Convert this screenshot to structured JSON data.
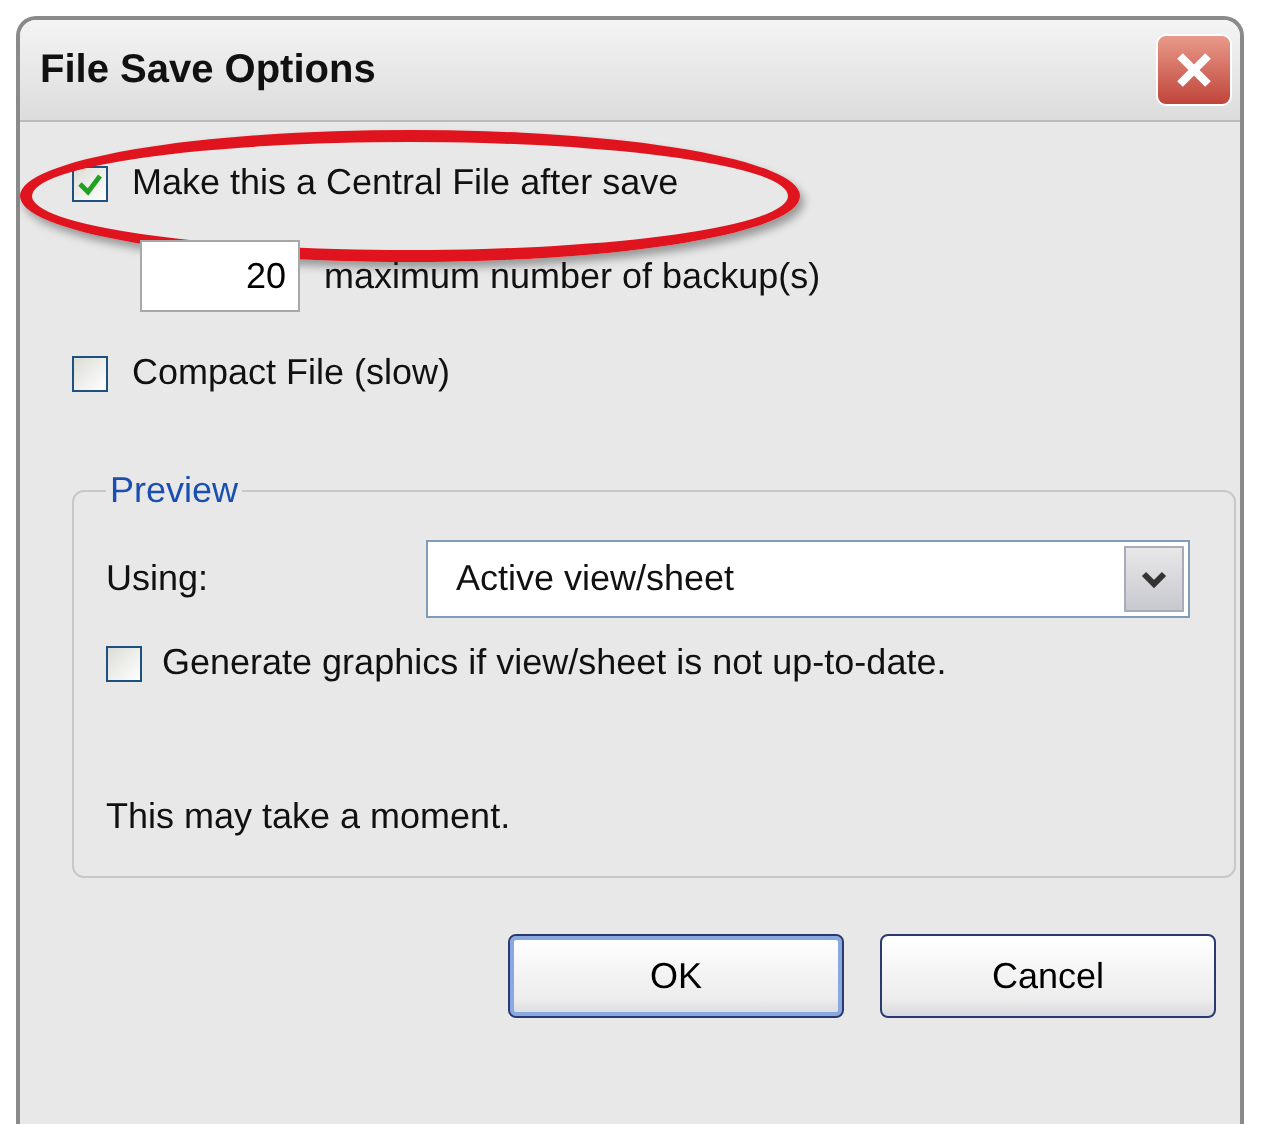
{
  "window": {
    "title": "File Save Options"
  },
  "central_file": {
    "label": "Make this a Central File after save",
    "checked": true,
    "highlighted": true
  },
  "backups": {
    "value": "20",
    "label": "maximum number of backup(s)"
  },
  "compact": {
    "label": "Compact File (slow)",
    "checked": false
  },
  "preview": {
    "title": "Preview",
    "using_label": "Using:",
    "using_value": "Active view/sheet",
    "generate": {
      "label": "Generate graphics if view/sheet is not up-to-date.",
      "checked": false
    },
    "note": "This may take a moment."
  },
  "buttons": [
    {
      "label": "OK",
      "default": true
    },
    {
      "label": "Cancel",
      "default": false
    }
  ]
}
